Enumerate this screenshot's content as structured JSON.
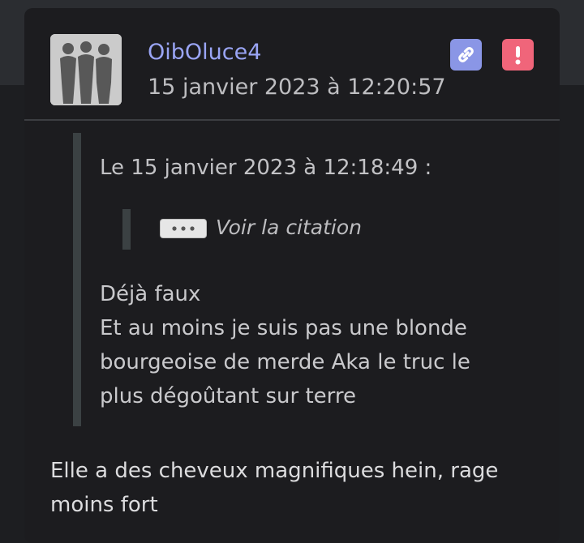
{
  "post": {
    "username": "OibOluce4",
    "date": "15 janvier 2023 à 12:20:57",
    "avatar_icon": "avatar-silhouettes-image",
    "actions": {
      "link_icon": "link-icon",
      "report_icon": "exclamation-icon",
      "link_color": "#8a96e6",
      "report_color": "#f0657a"
    },
    "quote": {
      "header": "Le 15 janvier 2023 à 12:18:49 :",
      "nested_quote_label": "Voir la citation",
      "lines": [
        "Déjà faux",
        "Et au moins je suis pas une blonde",
        "bourgeoise de merde Aka le truc le",
        "plus dégoûtant sur terre"
      ]
    },
    "reply_lines": [
      "Elle a des cheveux magnifiques hein, rage",
      "moins fort"
    ]
  },
  "colors": {
    "username": "#9aa5f5",
    "background": "#1d1e21",
    "card": "#1c1c1f"
  }
}
